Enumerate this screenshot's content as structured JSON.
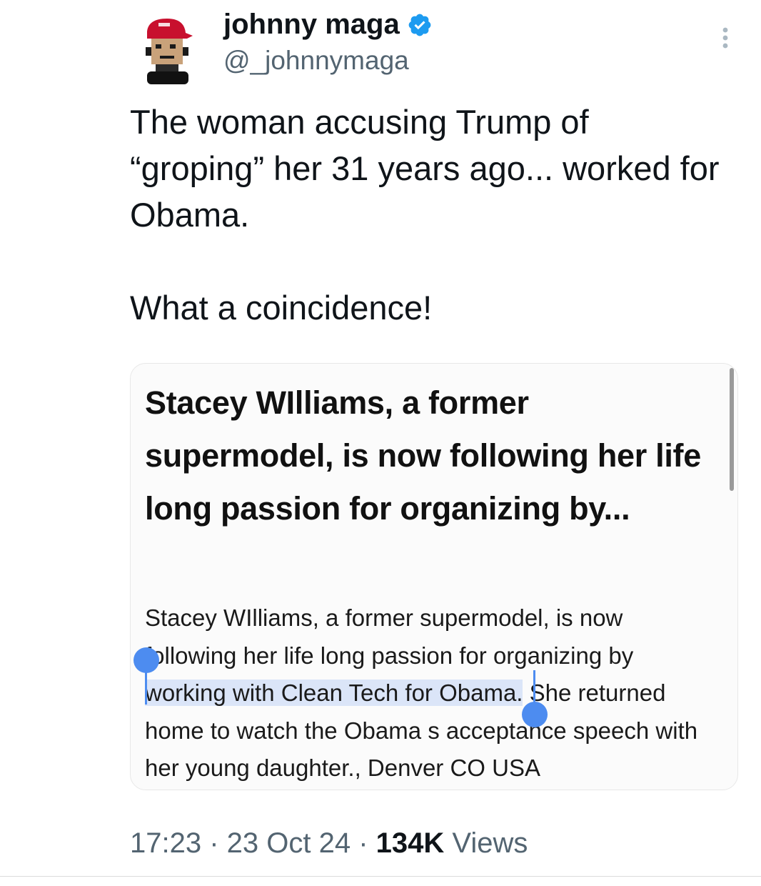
{
  "author": {
    "display_name": "johnny maga",
    "handle": "@_johnnymaga",
    "avatar_icon": "pixel-avatar-red-cap-icon",
    "verified_icon": "verified-badge-icon",
    "verified_color": "#1d9bf0"
  },
  "more_icon": "more-options-icon",
  "tweet": {
    "paragraph_1": "The woman accusing Trump of “groping” her 31 years ago... worked for Obama.",
    "paragraph_2": "What a coincidence!"
  },
  "card": {
    "title": "Stacey WIlliams, a former supermodel, is now following her life long passion for organizing by...",
    "desc_line_1": "Stacey WIlliams, a former supermodel, is now",
    "desc_line_2": "following her life long passion for organizing by",
    "desc_line_3_selected": "working with Clean Tech for Obama.",
    "desc_line_3_rest": " She returned",
    "desc_line_4": "home to watch the Obama s acceptance speech with",
    "desc_line_5": "her young daughter., Denver CO USA",
    "selection_color": "#dbe5f8",
    "selection_handle_color": "#4d8cf0"
  },
  "meta": {
    "time": "17:23",
    "sep_1": " · ",
    "date": "23 Oct 24",
    "sep_2": " · ",
    "views_count": "134K",
    "views_label": " Views"
  }
}
